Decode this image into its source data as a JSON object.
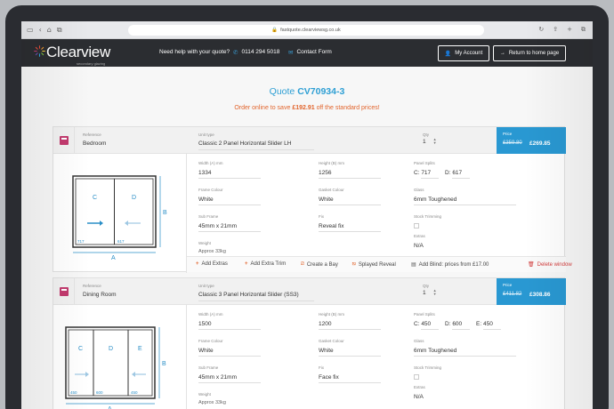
{
  "browser": {
    "url": "fastquote.clearviewsg.co.uk"
  },
  "header": {
    "logo_text": "Clearview",
    "logo_subtitle": "secondary glazing",
    "help_text": "Need help with your quote?",
    "phone": "0114 294 5018",
    "contact_label": "Contact Form",
    "account_label": "My Account",
    "home_label": "Return to home page",
    "colors": {
      "accent_blue": "#2998d2",
      "accent_orange": "#e2652d",
      "header_bg": "#2b2d31"
    }
  },
  "quote": {
    "title_prefix": "Quote",
    "number": "CV70934-3",
    "save_prefix": "Order online to save",
    "save_amount": "£192.91",
    "save_suffix": "off the standard prices!"
  },
  "labels": {
    "reference": "Reference",
    "unit_type": "Unit type",
    "qty": "Qty",
    "price": "Price",
    "width": "Width (A) mm",
    "height": "Height (B) mm",
    "panel_splits": "Panel Splits",
    "frame_colour": "Frame Colour",
    "gasket_colour": "Gasket Colour",
    "glass": "Glass",
    "sub_frame": "Sub Frame",
    "fix": "Fix",
    "stock_trimming": "Stock Trimming",
    "weight": "Weight",
    "extras": "Extras"
  },
  "windows": [
    {
      "reference": "Bedroom",
      "unit_type": "Classic 2 Panel Horizontal Slider LH",
      "qty": "1",
      "old_price": "£359.80",
      "new_price": "£269.85",
      "width": "1334",
      "height": "1256",
      "splits": [
        {
          "label": "C:",
          "value": "717"
        },
        {
          "label": "D:",
          "value": "617"
        }
      ],
      "frame_colour": "White",
      "gasket_colour": "White",
      "glass": "6mm Toughened",
      "sub_frame": "45mm x 21mm",
      "fix": "Reveal fix",
      "weight": "Approx 33kg",
      "extras": "N/A",
      "diagram": {
        "panels": [
          "C",
          "D"
        ],
        "split_labels": [
          "717",
          "617"
        ],
        "width_letter": "A",
        "height_letter": "B"
      }
    },
    {
      "reference": "Dining Room",
      "unit_type": "Classic 3 Panel Horizontal Slider (SS3)",
      "qty": "1",
      "old_price": "£411.82",
      "new_price": "£308.86",
      "width": "1500",
      "height": "1200",
      "splits": [
        {
          "label": "C:",
          "value": "450"
        },
        {
          "label": "D:",
          "value": "600"
        },
        {
          "label": "E:",
          "value": "450"
        }
      ],
      "frame_colour": "White",
      "gasket_colour": "White",
      "glass": "6mm Toughened",
      "sub_frame": "45mm x 21mm",
      "fix": "Face fix",
      "weight": "Approx 33kg",
      "extras": "N/A",
      "diagram": {
        "panels": [
          "C",
          "D",
          "E"
        ],
        "split_labels": [
          "450",
          "600",
          "450"
        ],
        "width_letter": "A",
        "height_letter": "B"
      }
    }
  ],
  "toolbar": {
    "add_extras": "Add Extras",
    "add_extra_trim": "Add Extra Trim",
    "create_bay": "Create a Bay",
    "splayed_reveal": "Splayed Reveal",
    "add_blind": "Add Blind: prices from £17.00",
    "delete_window": "Delete window"
  }
}
